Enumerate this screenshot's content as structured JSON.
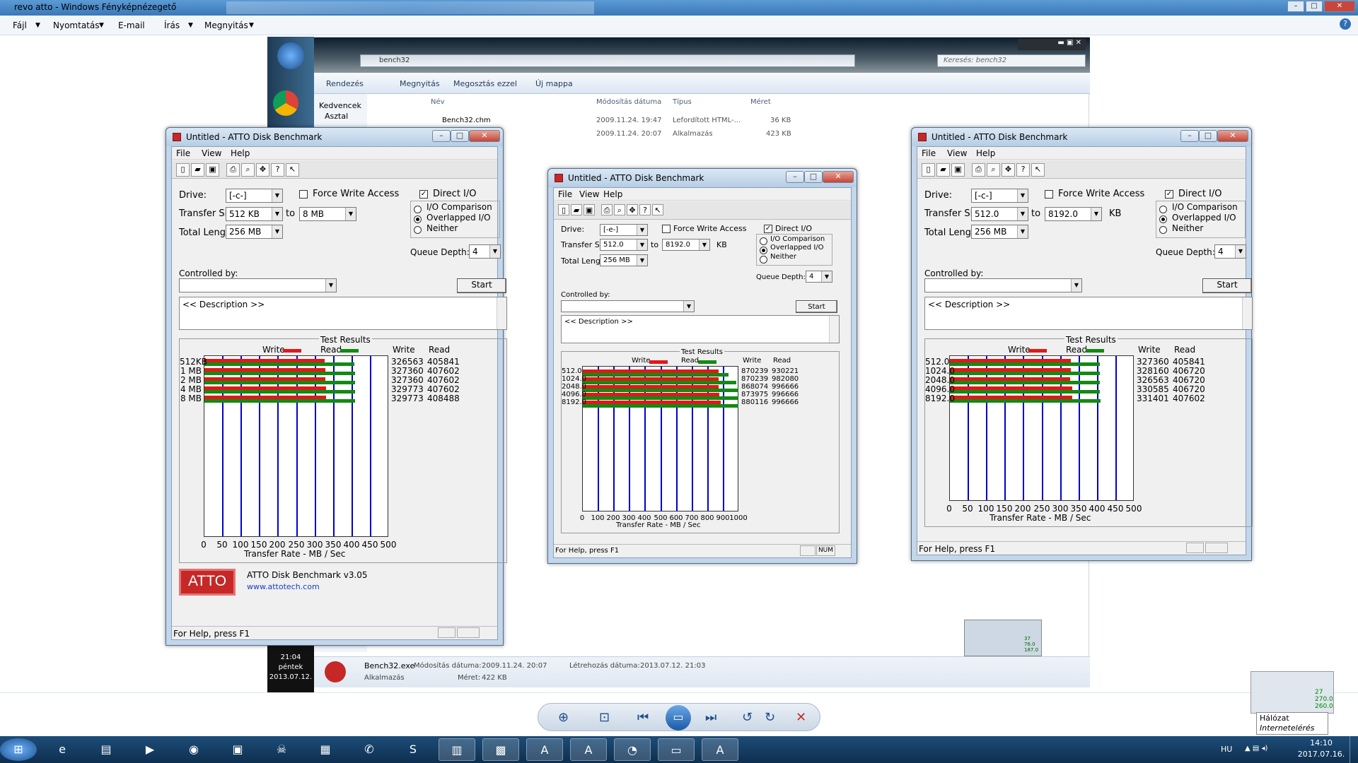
{
  "viewer": {
    "title": "revo atto - Windows Fényképnézegető",
    "menu": [
      "Fájl",
      "Nyomtatás",
      "E-mail",
      "Írás",
      "Megnyitás"
    ],
    "help_icon": "help-icon"
  },
  "explorer": {
    "address": "bench32",
    "search_placeholder": "Keresés: bench32",
    "commands": [
      "Rendezés",
      "Megnyitás",
      "Megosztás ezzel",
      "Új mappa"
    ],
    "sidebar": [
      "Kedvencek",
      "Asztal"
    ],
    "columns": [
      "Név",
      "Módosítás dátuma",
      "Típus",
      "Méret"
    ],
    "files": [
      {
        "name": "Bench32.chm",
        "date": "2009.11.24. 19:47",
        "type": "Lefordított HTML-...",
        "size": "36 KB"
      },
      {
        "name": "",
        "date": "2009.11.24. 20:07",
        "type": "Alkalmazás",
        "size": "423 KB"
      }
    ],
    "status": {
      "name": "Bench32.exe",
      "modified_label": "Módosítás dátuma:",
      "modified": "2009.11.24. 20:07",
      "created_label": "Létrehozás dátuma:",
      "created": "2013.07.12. 21:03",
      "type": "Alkalmazás",
      "size_label": "Méret:",
      "size": "422 KB"
    },
    "clock": {
      "time": "21:04",
      "day": "péntek",
      "date": "2013.07.12."
    }
  },
  "windows": [
    {
      "title": "Untitled - ATTO Disk Benchmark",
      "menu": [
        "File",
        "View",
        "Help"
      ],
      "drive_label": "Drive:",
      "drive": "[-c-]",
      "force_write": "Force Write Access",
      "direct_io": "Direct I/O",
      "transfer_label": "Transfer Size:",
      "transfer_from": "512 KB",
      "to": "to",
      "transfer_to": "8 MB",
      "kb": "",
      "total_label": "Total Length:",
      "total": "256 MB",
      "io_comparison": "I/O Comparison",
      "overlapped": "Overlapped I/O",
      "neither": "Neither",
      "queue_label": "Queue Depth:",
      "queue": "4",
      "controlled_label": "Controlled by:",
      "start": "Start",
      "description": "<< Description >>",
      "results_title": "Test Results",
      "legend_write": "Write",
      "legend_read": "Read",
      "col_write": "Write",
      "col_read": "Read",
      "axis_title": "Transfer Rate - MB / Sec",
      "footer_product": "ATTO Disk Benchmark v3.05",
      "footer_url": "www.attotech.com",
      "logo": "ATTO",
      "status": "For Help, press F1",
      "num": ""
    },
    {
      "title": "Untitled - ATTO Disk Benchmark",
      "menu": [
        "File",
        "View",
        "Help"
      ],
      "drive_label": "Drive:",
      "drive": "[-e-]",
      "force_write": "Force Write Access",
      "direct_io": "Direct I/O",
      "transfer_label": "Transfer Size:",
      "transfer_from": "512.0",
      "to": "to",
      "transfer_to": "8192.0",
      "kb": "KB",
      "total_label": "Total Length:",
      "total": "256 MB",
      "io_comparison": "I/O Comparison",
      "overlapped": "Overlapped I/O",
      "neither": "Neither",
      "queue_label": "Queue Depth:",
      "queue": "4",
      "controlled_label": "Controlled by:",
      "start": "Start",
      "description": "<< Description >>",
      "results_title": "Test Results",
      "legend_write": "Write",
      "legend_read": "Read",
      "col_write": "Write",
      "col_read": "Read",
      "axis_title": "Transfer Rate - MB / Sec",
      "status": "For Help, press F1",
      "num": "NUM"
    },
    {
      "title": "Untitled - ATTO Disk Benchmark",
      "menu": [
        "File",
        "View",
        "Help"
      ],
      "drive_label": "Drive:",
      "drive": "[-c-]",
      "force_write": "Force Write Access",
      "direct_io": "Direct I/O",
      "transfer_label": "Transfer Size:",
      "transfer_from": "512.0",
      "to": "to",
      "transfer_to": "8192.0",
      "kb": "KB",
      "total_label": "Total Length:",
      "total": "256 MB",
      "io_comparison": "I/O Comparison",
      "overlapped": "Overlapped I/O",
      "neither": "Neither",
      "queue_label": "Queue Depth:",
      "queue": "4",
      "controlled_label": "Controlled by:",
      "start": "Start",
      "description": "<< Description >>",
      "results_title": "Test Results",
      "legend_write": "Write",
      "legend_read": "Read",
      "col_write": "Write",
      "col_read": "Read",
      "axis_title": "Transfer Rate - MB / Sec",
      "status": "For Help, press F1",
      "num": ""
    }
  ],
  "chart_data": [
    {
      "type": "bar",
      "categories": [
        "512KB",
        "1 MB",
        "2 MB",
        "4 MB",
        "8 MB"
      ],
      "series": [
        {
          "name": "Write",
          "values": [
            326563,
            327360,
            327360,
            329773,
            329773
          ]
        },
        {
          "name": "Read",
          "values": [
            405841,
            407602,
            407602,
            407602,
            408488
          ]
        }
      ],
      "xlabel": "Transfer Rate - MB / Sec",
      "xlim": [
        0,
        500
      ],
      "xticks": [
        "0",
        "50",
        "100",
        "150",
        "200",
        "250",
        "300",
        "350",
        "400",
        "450",
        "500"
      ],
      "orientation": "horizontal"
    },
    {
      "type": "bar",
      "categories": [
        "512.0",
        "1024.0",
        "2048.0",
        "4096.0",
        "8192.0"
      ],
      "series": [
        {
          "name": "Write",
          "values": [
            870239,
            870239,
            868074,
            873975,
            880116
          ]
        },
        {
          "name": "Read",
          "values": [
            930221,
            982080,
            996666,
            996666,
            996666
          ]
        }
      ],
      "xlabel": "Transfer Rate - MB / Sec",
      "xlim": [
        0,
        1000
      ],
      "xticks": [
        "0",
        "100",
        "200",
        "300",
        "400",
        "500",
        "600",
        "700",
        "800",
        "900",
        "1000"
      ],
      "orientation": "horizontal"
    },
    {
      "type": "bar",
      "categories": [
        "512.0",
        "1024.0",
        "2048.0",
        "4096.0",
        "8192.0"
      ],
      "series": [
        {
          "name": "Write",
          "values": [
            327360,
            328160,
            326563,
            330585,
            331401
          ]
        },
        {
          "name": "Read",
          "values": [
            405841,
            406720,
            406720,
            406720,
            407602
          ]
        }
      ],
      "xlabel": "Transfer Rate - MB / Sec",
      "xlim": [
        0,
        500
      ],
      "xticks": [
        "0",
        "50",
        "100",
        "150",
        "200",
        "250",
        "300",
        "350",
        "400",
        "450",
        "500"
      ],
      "orientation": "horizontal"
    }
  ],
  "photo_viewer_controls": [
    "zoom-icon",
    "fit-icon",
    "previous-icon",
    "slideshow-icon",
    "next-icon",
    "rotate-left-icon",
    "rotate-right-icon",
    "delete-icon"
  ],
  "tray": {
    "lang": "HU",
    "time": "14:10",
    "date": "2017.07.16.",
    "network_tooltip_1": "Hálózat",
    "network_tooltip_2": "Internetelérés",
    "gadget_values": [
      "27",
      "270.0",
      "260.0"
    ],
    "gadget_values_small": [
      "37",
      "76.0",
      "187.0"
    ]
  },
  "colors": {
    "write": "#e21818",
    "read": "#138a13",
    "grid": "#0000cc",
    "atto_red": "#c62828"
  }
}
